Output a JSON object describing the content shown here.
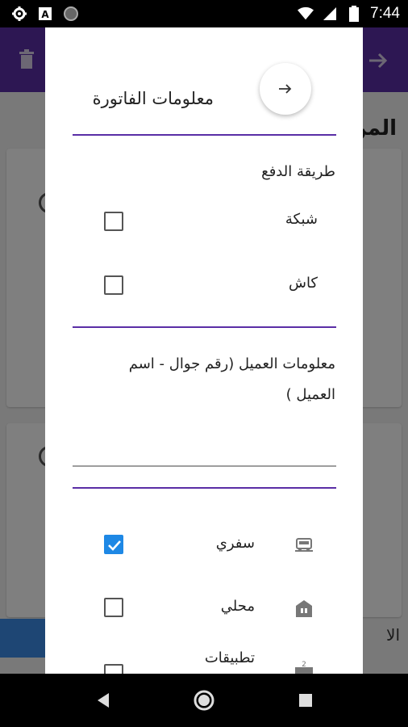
{
  "status_bar": {
    "time": "7:44",
    "icons": [
      "gear-icon",
      "a-badge-icon",
      "circle-icon",
      "wifi-icon",
      "signal-icon",
      "battery-icon"
    ]
  },
  "background": {
    "title": "المن",
    "bottom_label": "الا",
    "toolbar_color": "#5a2ea6"
  },
  "dialog": {
    "title": "معلومات الفاتورة",
    "back_icon": "arrow-right-icon",
    "payment_method": {
      "label": "طريقة الدفع",
      "options": [
        {
          "label": "شبكة",
          "checked": false
        },
        {
          "label": "كاش",
          "checked": false
        }
      ]
    },
    "customer": {
      "label": "معلومات العميل (رقم جوال - اسم العميل )",
      "value": ""
    },
    "order_types": [
      {
        "label": "سفري",
        "icon": "car-icon",
        "checked": true
      },
      {
        "label": "محلي",
        "icon": "store-icon",
        "checked": false
      },
      {
        "label": "تطبيقات",
        "icon": "delivery-icon",
        "checked": false
      }
    ]
  },
  "nav_bar": {
    "icons": [
      "back-triangle-icon",
      "home-circle-icon",
      "recents-square-icon"
    ]
  },
  "colors": {
    "accent": "#5a2ea6",
    "checkbox_checked": "#1e88e5"
  }
}
